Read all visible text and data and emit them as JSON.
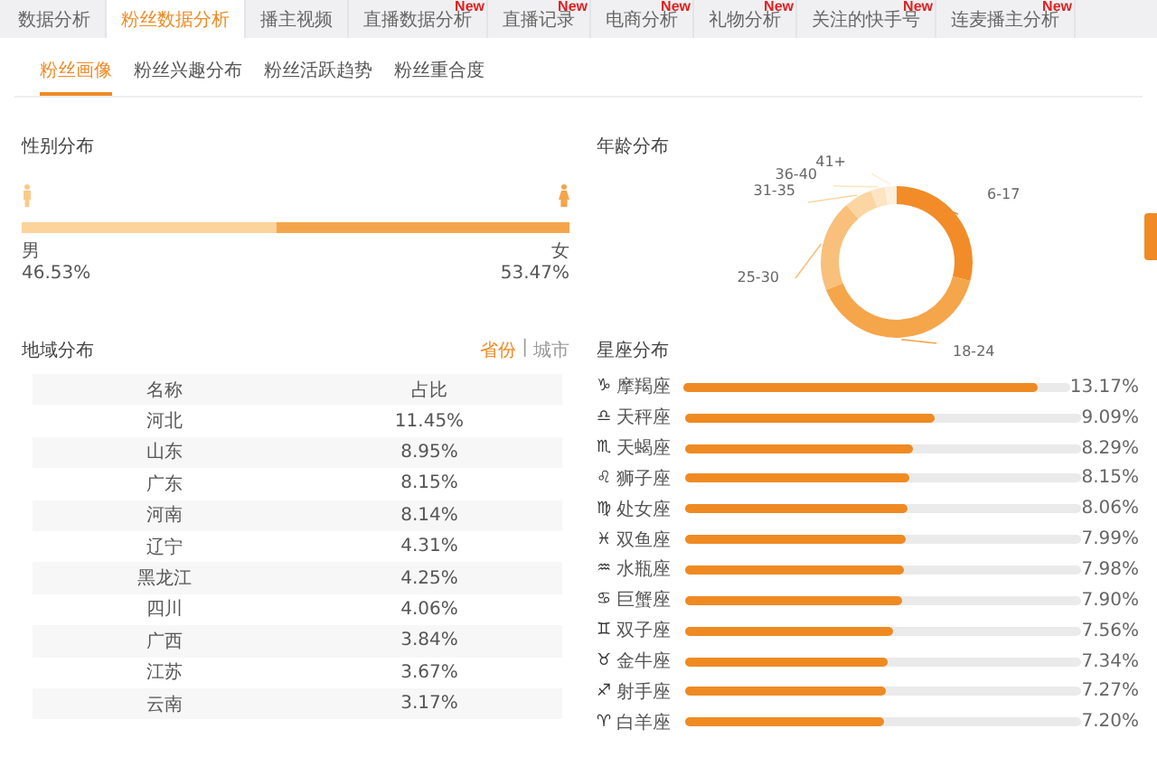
{
  "tabs": [
    {
      "label": "数据分析",
      "selected": false
    },
    {
      "label": "粉丝数据分析",
      "selected": true
    },
    {
      "label": "播主视频",
      "selected": false
    },
    {
      "label": "直播数据分析",
      "selected": false,
      "badge": "New"
    },
    {
      "label": "直播记录",
      "selected": false,
      "badge": "New"
    },
    {
      "label": "电商分析",
      "selected": false,
      "badge": "New"
    },
    {
      "label": "礼物分析",
      "selected": false,
      "badge": "New"
    },
    {
      "label": "关注的快手号",
      "selected": false,
      "badge": "New"
    },
    {
      "label": "连麦播主分析",
      "selected": false,
      "badge": "New"
    }
  ],
  "subtabs": [
    {
      "label": "粉丝画像",
      "selected": true
    },
    {
      "label": "粉丝兴趣分布",
      "selected": false
    },
    {
      "label": "粉丝活跃趋势",
      "selected": false
    },
    {
      "label": "粉丝重合度",
      "selected": false
    }
  ],
  "gender": {
    "title": "性别分布",
    "level": 0.4653,
    "male": {
      "label": "男",
      "value": "46.53%"
    },
    "female": {
      "label": "女",
      "value": "53.47%"
    }
  },
  "age": {
    "title": "年龄分布",
    "segments": [
      {
        "label": "6-17",
        "color": "#f28c28"
      },
      {
        "label": "18-24",
        "color": "#f5a54a"
      },
      {
        "label": "25-30",
        "color": "#f8c07a"
      },
      {
        "label": "31-35",
        "color": "#fbd5a2"
      },
      {
        "label": "36-40",
        "color": "#fde4c2"
      },
      {
        "label": "41+",
        "color": "#fef0dd"
      }
    ]
  },
  "region": {
    "title": "地域分布",
    "toggle": [
      {
        "label": "省份",
        "selected": true
      },
      {
        "label": "城市",
        "selected": false
      }
    ],
    "separator": "|",
    "columns": [
      "名称",
      "占比"
    ],
    "rows": [
      [
        "河北",
        "11.45%"
      ],
      [
        "山东",
        "8.95%"
      ],
      [
        "广东",
        "8.15%"
      ],
      [
        "河南",
        "8.14%"
      ],
      [
        "辽宁",
        "4.31%"
      ],
      [
        "黑龙江",
        "4.25%"
      ],
      [
        "四川",
        "4.06%"
      ],
      [
        "广西",
        "3.84%"
      ],
      [
        "江苏",
        "3.67%"
      ],
      [
        "云南",
        "3.17%"
      ]
    ]
  },
  "zodiac": {
    "title": "星座分布",
    "rows": [
      {
        "symbol": "♑",
        "name": "摩羯座",
        "level": 0.915,
        "value": "13.17%"
      },
      {
        "symbol": "♎",
        "name": "天秤座",
        "level": 0.631,
        "value": "9.09%"
      },
      {
        "symbol": "♏",
        "name": "天蝎座",
        "level": 0.576,
        "value": "8.29%"
      },
      {
        "symbol": "♌",
        "name": "狮子座",
        "level": 0.566,
        "value": "8.15%"
      },
      {
        "symbol": "♍",
        "name": "处女座",
        "level": 0.56,
        "value": "8.06%"
      },
      {
        "symbol": "♓",
        "name": "双鱼座",
        "level": 0.555,
        "value": "7.99%"
      },
      {
        "symbol": "♒",
        "name": "水瓶座",
        "level": 0.554,
        "value": "7.98%"
      },
      {
        "symbol": "♋",
        "name": "巨蟹座",
        "level": 0.549,
        "value": "7.90%"
      },
      {
        "symbol": "♊",
        "name": "双子座",
        "level": 0.525,
        "value": "7.56%"
      },
      {
        "symbol": "♉",
        "name": "金牛座",
        "level": 0.51,
        "value": "7.34%"
      },
      {
        "symbol": "♐",
        "name": "射手座",
        "level": 0.505,
        "value": "7.27%"
      },
      {
        "symbol": "♈",
        "name": "白羊座",
        "level": 0.5,
        "value": "7.20%"
      }
    ]
  }
}
